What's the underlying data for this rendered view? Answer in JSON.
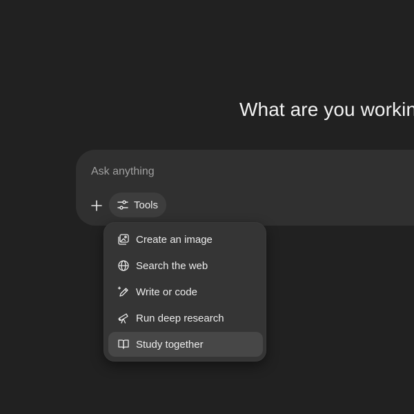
{
  "heading": "What are you workin",
  "composer": {
    "placeholder": "Ask anything",
    "plus_icon": "plus-icon",
    "tools_label": "Tools",
    "tools_icon": "sliders-icon"
  },
  "tools_menu": {
    "items": [
      {
        "label": "Create an image",
        "icon": "image-icon",
        "selected": false
      },
      {
        "label": "Search the web",
        "icon": "globe-icon",
        "selected": false
      },
      {
        "label": "Write or code",
        "icon": "pen-sparkle-icon",
        "selected": false
      },
      {
        "label": "Run deep research",
        "icon": "telescope-icon",
        "selected": false
      },
      {
        "label": "Study together",
        "icon": "book-icon",
        "selected": true
      }
    ]
  },
  "colors": {
    "background": "#212121",
    "composer": "#303030",
    "menu": "#353535",
    "selected_item": "#474747",
    "text": "#ececec",
    "placeholder": "#a0a0a0"
  }
}
